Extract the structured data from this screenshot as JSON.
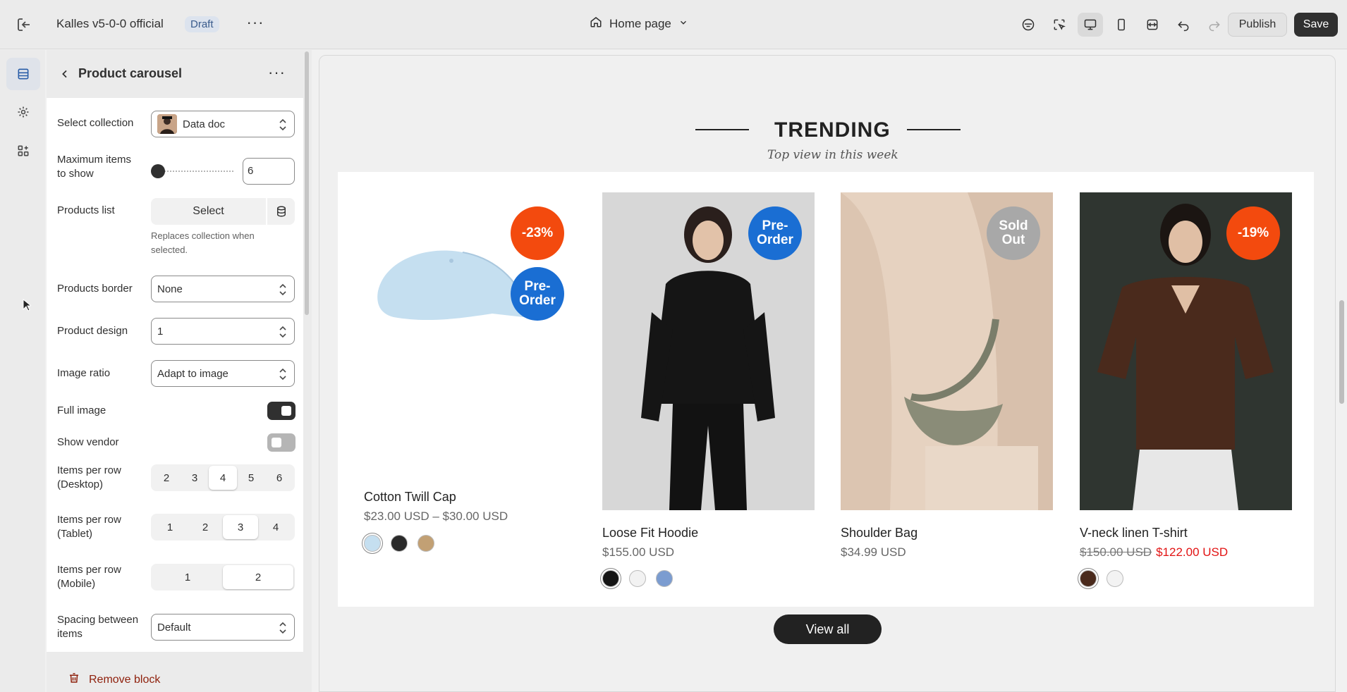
{
  "topbar": {
    "store_name": "Kalles v5-0-0 official",
    "status_badge": "Draft",
    "page_selector": "Home page",
    "publish_label": "Publish",
    "save_label": "Save"
  },
  "panel": {
    "title": "Product carousel",
    "select_collection_label": "Select collection",
    "select_collection_value": "Data doc",
    "max_items_label": "Maximum items to show",
    "max_items_value": "6",
    "products_list_label": "Products list",
    "products_list_button": "Select",
    "products_list_help": "Replaces collection when selected.",
    "products_border_label": "Products border",
    "products_border_value": "None",
    "product_design_label": "Product design",
    "product_design_value": "1",
    "image_ratio_label": "Image ratio",
    "image_ratio_value": "Adapt to image",
    "full_image_label": "Full image",
    "full_image_on": true,
    "show_vendor_label": "Show vendor",
    "show_vendor_on": false,
    "desktop_label": "Items per row (Desktop)",
    "desktop_options": [
      "2",
      "3",
      "4",
      "5",
      "6"
    ],
    "desktop_selected": "4",
    "tablet_label": "Items per row (Tablet)",
    "tablet_options": [
      "1",
      "2",
      "3",
      "4"
    ],
    "tablet_selected": "3",
    "mobile_label": "Items per row (Mobile)",
    "mobile_options": [
      "1",
      "2"
    ],
    "mobile_selected": "2",
    "spacing_label": "Spacing between items",
    "spacing_value": "Default",
    "remove_label": "Remove block"
  },
  "preview": {
    "heading": "TRENDING",
    "subheading": "Top view in this week",
    "view_all": "View all",
    "products": [
      {
        "name": "Cotton Twill Cap",
        "price": "$23.00 USD – $30.00 USD",
        "badges": [
          "-23%",
          "Pre-Order"
        ]
      },
      {
        "name": "Loose Fit Hoodie",
        "price": "$155.00 USD",
        "badges": [
          "Pre-Order"
        ]
      },
      {
        "name": "Shoulder Bag",
        "price": "$34.99 USD",
        "badges": [
          "Sold Out"
        ]
      },
      {
        "name": "V-neck linen T-shirt",
        "old_price": "$150.00 USD",
        "new_price": "$122.00 USD",
        "badges": [
          "-19%"
        ]
      }
    ]
  },
  "colors": {
    "sale_badge": "#f34a0e",
    "preorder_badge": "#1a6ed3",
    "soldout_badge": "#a8a8a8",
    "sale_price": "#e21313",
    "remove": "#8e1f0b"
  }
}
